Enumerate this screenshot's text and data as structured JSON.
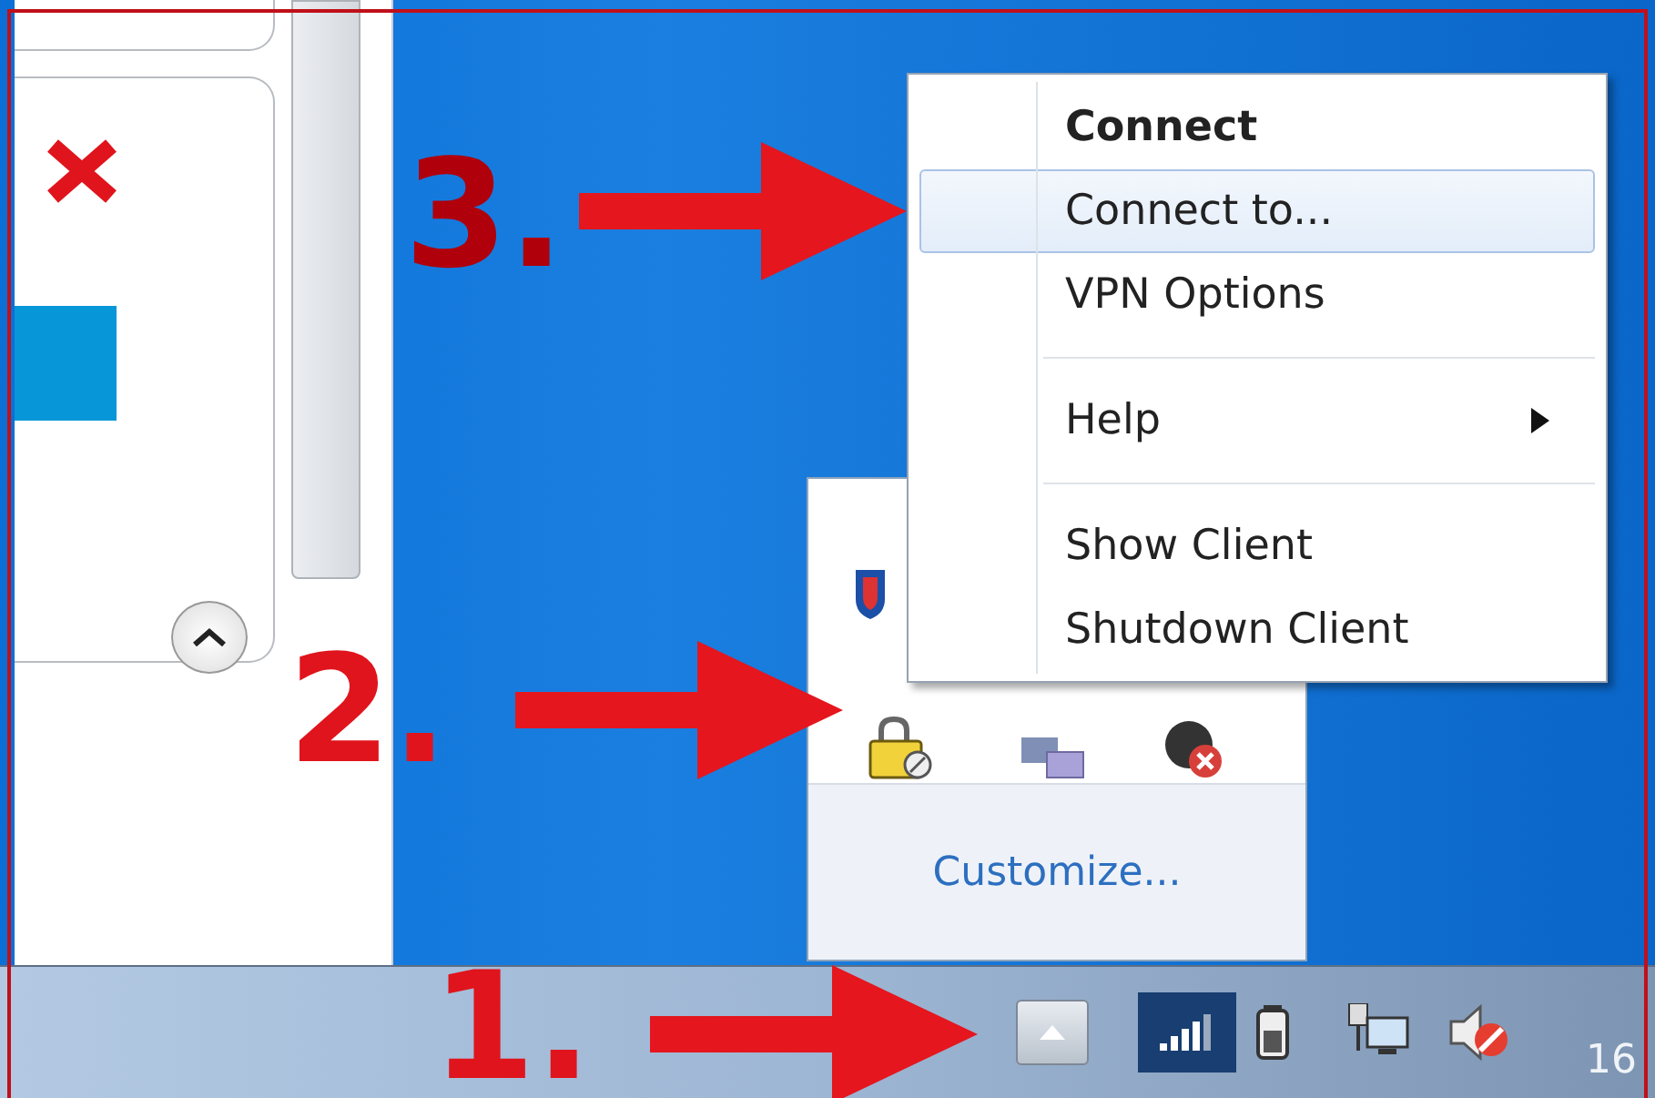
{
  "menu": {
    "items": [
      {
        "kind": "item",
        "label": "Connect",
        "bold": true,
        "selected": false,
        "submenu": false
      },
      {
        "kind": "item",
        "label": "Connect to...",
        "bold": false,
        "selected": true,
        "submenu": false
      },
      {
        "kind": "item",
        "label": "VPN Options",
        "bold": false,
        "selected": false,
        "submenu": false
      },
      {
        "kind": "separator"
      },
      {
        "kind": "item",
        "label": "Help",
        "bold": false,
        "selected": false,
        "submenu": true
      },
      {
        "kind": "separator"
      },
      {
        "kind": "item",
        "label": "Show Client",
        "bold": false,
        "selected": false,
        "submenu": false
      },
      {
        "kind": "item",
        "label": "Shutdown Client",
        "bold": false,
        "selected": false,
        "submenu": false
      }
    ]
  },
  "tray_popup": {
    "link": "Customize..."
  },
  "taskbar": {
    "clock": "16"
  },
  "annotations": [
    {
      "label": "3."
    },
    {
      "label": "2."
    },
    {
      "label": "1."
    }
  ]
}
